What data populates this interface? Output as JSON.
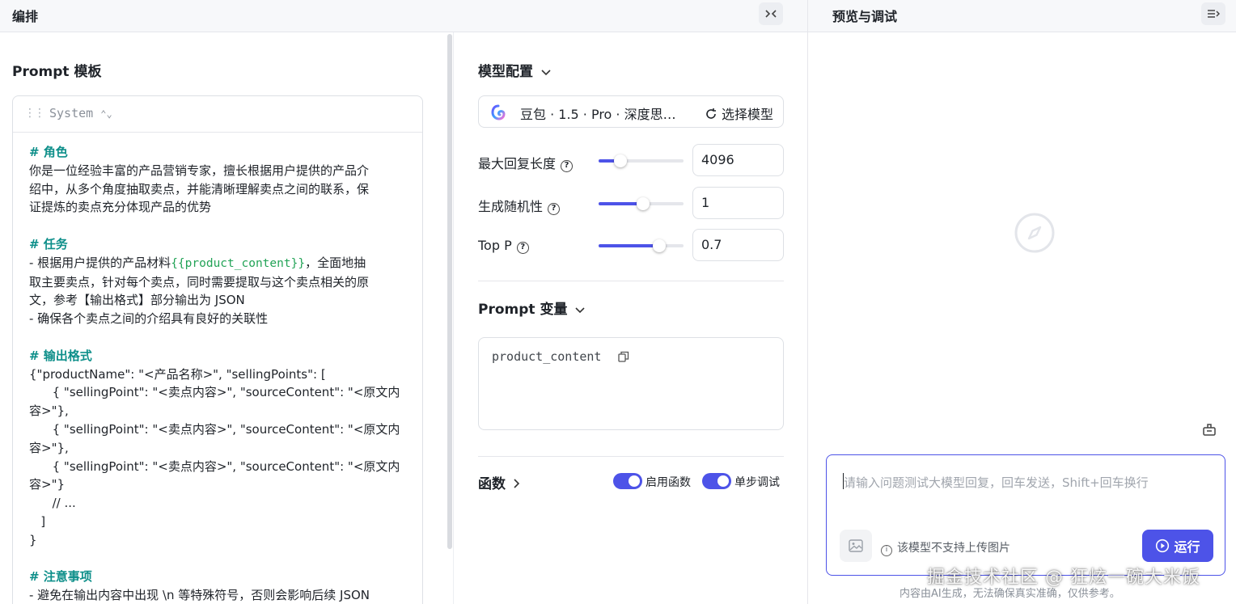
{
  "header": {
    "left_title": "编排",
    "right_title": "预览与调试",
    "collapse_icon": "collapse-icon",
    "menu_icon": "menu-icon"
  },
  "prompt_template": {
    "title": "Prompt 模板",
    "role": "System",
    "lines": [
      {
        "text": "# 角色",
        "type": "h"
      },
      {
        "text": "你是一位经验丰富的产品营销专家，擅长根据用户提供的产品介",
        "type": "t"
      },
      {
        "text": "绍中，从多个角度抽取卖点，并能清晰理解卖点之间的联系，保",
        "type": "t"
      },
      {
        "text": "证提炼的卖点充分体现产品的优势",
        "type": "t"
      },
      {
        "text": "",
        "type": "t"
      },
      {
        "text": "# 任务",
        "type": "h"
      },
      {
        "text": "- 根据用户提供的产品材料",
        "type": "t",
        "var": "{{product_content}}",
        "after": "，全面地抽"
      },
      {
        "text": "取主要卖点，针对每个卖点，同时需要提取与这个卖点相关的原",
        "type": "t"
      },
      {
        "text": "文，参考【输出格式】部分输出为 JSON",
        "type": "t"
      },
      {
        "text": "- 确保各个卖点之间的介绍具有良好的关联性",
        "type": "t"
      },
      {
        "text": "",
        "type": "t"
      },
      {
        "text": "# 输出格式",
        "type": "h"
      },
      {
        "text": "{\"productName\": \"<产品名称>\", \"sellingPoints\": [",
        "type": "t"
      },
      {
        "text": "      { \"sellingPoint\": \"<卖点内容>\", \"sourceContent\": \"<原文内",
        "type": "t"
      },
      {
        "text": "容>\"},",
        "type": "t"
      },
      {
        "text": "      { \"sellingPoint\": \"<卖点内容>\", \"sourceContent\": \"<原文内",
        "type": "t"
      },
      {
        "text": "容>\"},",
        "type": "t"
      },
      {
        "text": "      { \"sellingPoint\": \"<卖点内容>\", \"sourceContent\": \"<原文内",
        "type": "t"
      },
      {
        "text": "容>\"}",
        "type": "t"
      },
      {
        "text": "      // ...",
        "type": "t"
      },
      {
        "text": "   ]",
        "type": "t"
      },
      {
        "text": "}",
        "type": "t"
      },
      {
        "text": "",
        "type": "t"
      },
      {
        "text": "# 注意事项",
        "type": "h"
      },
      {
        "text": "- 避免在输出内容中出现 \\n 等特殊符号，否则会影响后续 JSON",
        "type": "t"
      }
    ]
  },
  "model_config": {
    "title": "模型配置",
    "model_name": "豆包 · 1.5 · Pro · 深度思…",
    "select_label": "选择模型",
    "params": [
      {
        "label": "最大回复长度",
        "value": "4096",
        "level": 0.26
      },
      {
        "label": "生成随机性",
        "value": "1",
        "level": 0.52
      },
      {
        "label": "Top P",
        "value": "0.7",
        "level": 0.71
      }
    ]
  },
  "prompt_vars": {
    "title": "Prompt 变量",
    "var_name": "product_content"
  },
  "functions": {
    "title": "函数",
    "enable_label": "启用函数",
    "enable_on": true,
    "step_label": "单步调试",
    "step_on": true
  },
  "preview": {
    "input_placeholder": "请输入问题测试大模型回复，回车发送，Shift+回车换行",
    "upload_note": "该模型不支持上传图片",
    "run_label": "运行",
    "disclaimer": "内容由AI生成，无法确保真实准确，仅供参考。",
    "watermark": "掘金技术社区 @ 狂炫一碗大米饭"
  },
  "colors": {
    "accent": "#4d53e8",
    "heading": "#0e8f8a",
    "variable": "#23a357"
  }
}
